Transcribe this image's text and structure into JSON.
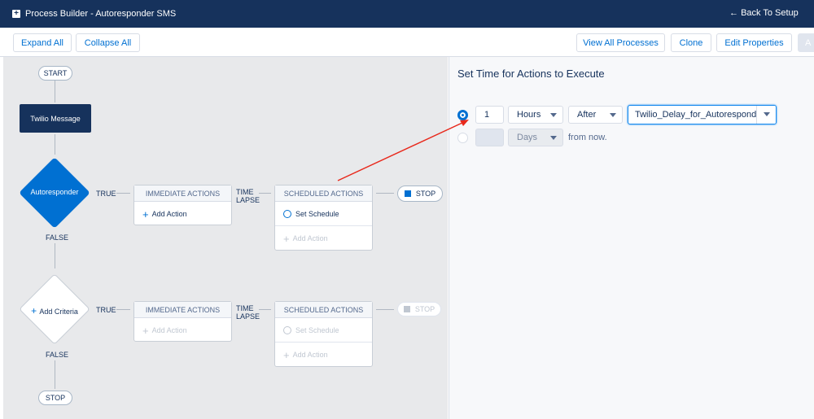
{
  "header": {
    "title": "Process Builder - Autoresponder SMS",
    "back": "Back To Setup"
  },
  "toolbar": {
    "expand_all": "Expand All",
    "collapse_all": "Collapse All",
    "view_all": "View All Processes",
    "clone": "Clone",
    "edit_properties": "Edit Properties",
    "activate": "A"
  },
  "canvas": {
    "start": "START",
    "object_node": "Twilio Message",
    "criteria": [
      {
        "label": "Autoresponder",
        "true": "TRUE",
        "false": "FALSE",
        "immediate": "IMMEDIATE ACTIONS",
        "add_action": "Add Action",
        "time_lapse": "TIME\nLAPSE",
        "scheduled": "SCHEDULED ACTIONS",
        "set_schedule": "Set Schedule",
        "add_action2": "Add Action",
        "stop": "STOP"
      },
      {
        "label": "Add Criteria",
        "true": "TRUE",
        "false": "FALSE",
        "immediate": "IMMEDIATE ACTIONS",
        "add_action": "Add Action",
        "time_lapse": "TIME\nLAPSE",
        "scheduled": "SCHEDULED ACTIONS",
        "set_schedule": "Set Schedule",
        "add_action2": "Add Action",
        "stop": "STOP"
      }
    ],
    "end_stop": "STOP"
  },
  "panel": {
    "title": "Set Time for Actions to Execute",
    "option1": {
      "selected": true,
      "number": "1",
      "unit": "Hours",
      "relation": "After",
      "field": "Twilio_Delay_for_Autoresponder"
    },
    "option2": {
      "selected": false,
      "number": "",
      "unit": "Days",
      "suffix": "from now."
    }
  },
  "colors": {
    "header": "#16325c",
    "brand": "#0070d2",
    "annotation_arrow": "#e8291c"
  }
}
